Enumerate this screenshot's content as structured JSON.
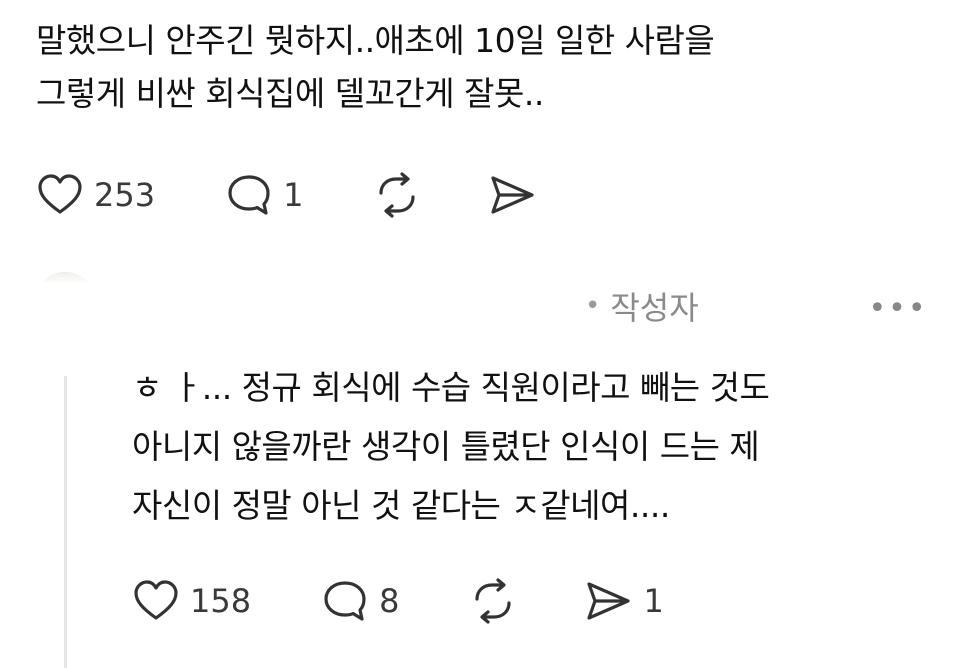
{
  "post": {
    "lines": [
      "말했으니 안주긴 뭣하지..애초에 10일 일한 사람을",
      "그렇게 비싼 회식집에 델꼬간게 잘못.."
    ],
    "likes": "253",
    "comments": "1"
  },
  "reply": {
    "author_badge": "작성자",
    "dot": "•",
    "more": "•••",
    "lines": [
      "ㅎ ㅏ... 정규 회식에 수습 직원이라고 빼는 것도",
      "아니지 않을까란 생각이 틀렸단 인식이 드는 제",
      "자신이 정말 아닌 것 같다는 ㅈ같네여...."
    ],
    "likes": "158",
    "comments": "8",
    "shares": "1"
  }
}
